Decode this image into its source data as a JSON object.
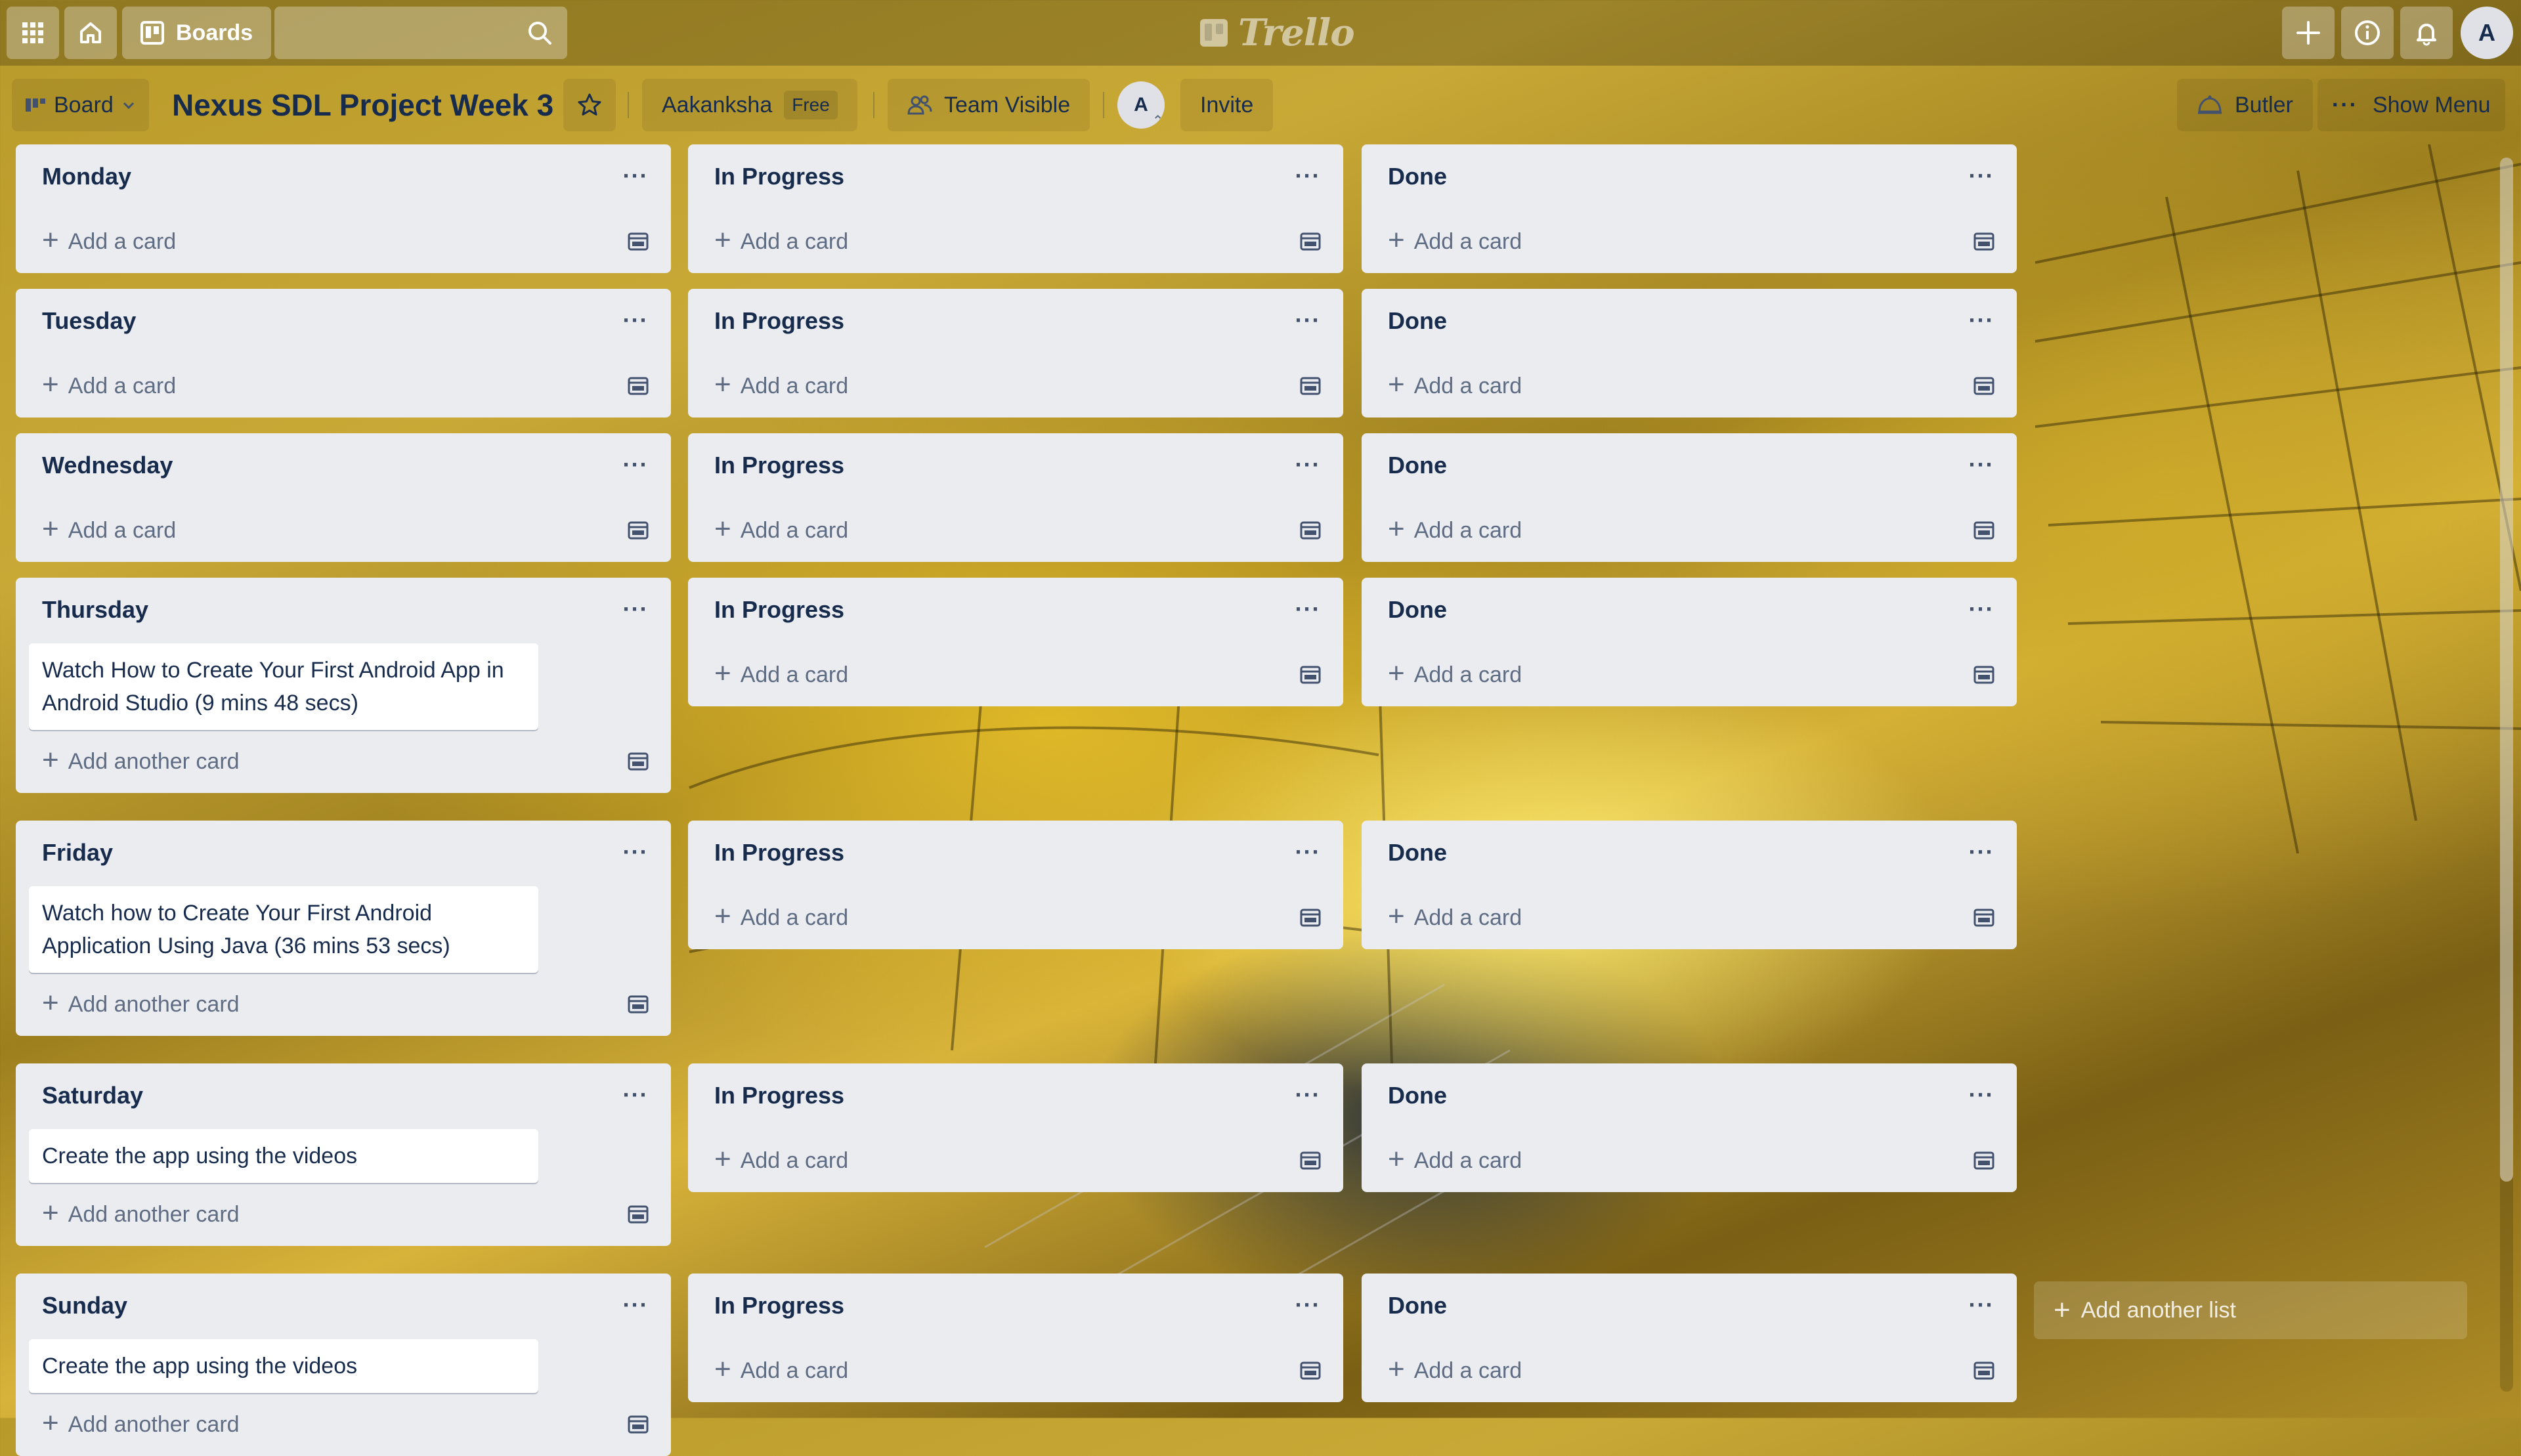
{
  "topbar": {
    "boards_label": "Boards",
    "search_placeholder": "",
    "logo_text": "Trello",
    "user_initial": "A"
  },
  "board": {
    "view_label": "Board",
    "title": "Nexus SDL Project Week 3",
    "team_name": "Aakanksha",
    "plan_badge": "Free",
    "visibility_label": "Team Visible",
    "member_initial": "A",
    "invite_label": "Invite",
    "butler_label": "Butler",
    "show_menu_label": "Show Menu"
  },
  "labels": {
    "add_card": "Add a card",
    "add_another_card": "Add another card",
    "add_another_list": "Add another list",
    "list_menu": "···"
  },
  "rows": [
    {
      "day": {
        "title": "Monday",
        "cards": []
      },
      "progress": {
        "title": "In Progress",
        "cards": []
      },
      "done": {
        "title": "Done",
        "cards": []
      }
    },
    {
      "day": {
        "title": "Tuesday",
        "cards": []
      },
      "progress": {
        "title": "In Progress",
        "cards": []
      },
      "done": {
        "title": "Done",
        "cards": []
      }
    },
    {
      "day": {
        "title": "Wednesday",
        "cards": []
      },
      "progress": {
        "title": "In Progress",
        "cards": []
      },
      "done": {
        "title": "Done",
        "cards": []
      }
    },
    {
      "day": {
        "title": "Thursday",
        "cards": [
          "Watch How to Create Your First Android App in Android Studio (9 mins 48 secs)"
        ]
      },
      "progress": {
        "title": "In Progress",
        "cards": []
      },
      "done": {
        "title": "Done",
        "cards": []
      }
    },
    {
      "day": {
        "title": "Friday",
        "cards": [
          "Watch how to Create Your First Android Application Using Java (36 mins 53 secs)"
        ]
      },
      "progress": {
        "title": "In Progress",
        "cards": []
      },
      "done": {
        "title": "Done",
        "cards": []
      }
    },
    {
      "day": {
        "title": "Saturday",
        "cards": [
          "Create the app using the videos"
        ]
      },
      "progress": {
        "title": "In Progress",
        "cards": []
      },
      "done": {
        "title": "Done",
        "cards": []
      }
    },
    {
      "day": {
        "title": "Sunday",
        "cards": [
          "Create the app using the videos"
        ]
      },
      "progress": {
        "title": "In Progress",
        "cards": []
      },
      "done": {
        "title": "Done",
        "cards": []
      }
    }
  ]
}
